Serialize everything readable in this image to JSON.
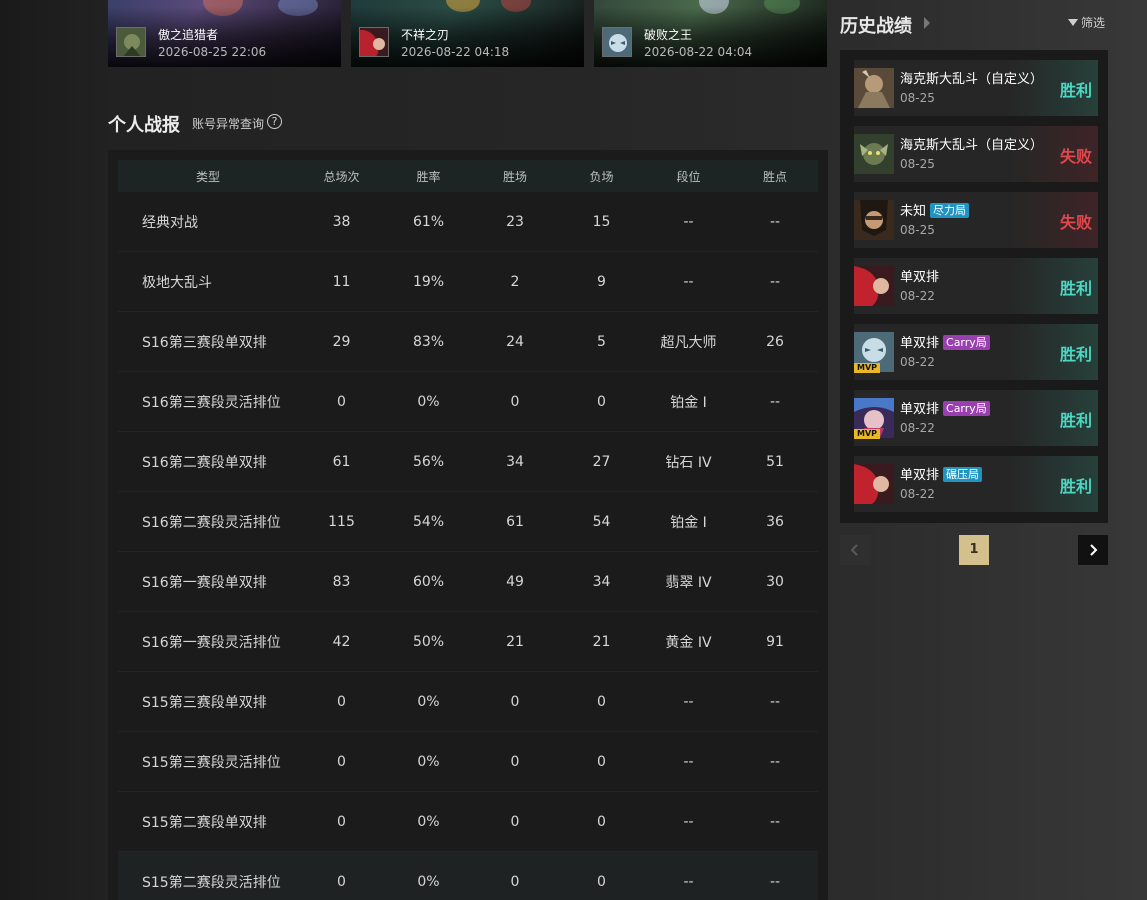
{
  "highlights": [
    {
      "name": "傲之追猎者",
      "time": "2026-08-25 22:06"
    },
    {
      "name": "不祥之刃",
      "time": "2026-08-22 04:18"
    },
    {
      "name": "破败之王",
      "time": "2026-08-22 04:04"
    }
  ],
  "personal": {
    "title": "个人战报",
    "abnormal_link": "账号异常查询",
    "help_icon": "?"
  },
  "stats": {
    "headers": [
      "类型",
      "总场次",
      "胜率",
      "胜场",
      "负场",
      "段位",
      "胜点"
    ],
    "rows": [
      [
        "经典对战",
        "38",
        "61%",
        "23",
        "15",
        "--",
        "--"
      ],
      [
        "极地大乱斗",
        "11",
        "19%",
        "2",
        "9",
        "--",
        "--"
      ],
      [
        "S16第三赛段单双排",
        "29",
        "83%",
        "24",
        "5",
        "超凡大师",
        "26"
      ],
      [
        "S16第三赛段灵活排位",
        "0",
        "0%",
        "0",
        "0",
        "铂金 Ⅰ",
        "--"
      ],
      [
        "S16第二赛段单双排",
        "61",
        "56%",
        "34",
        "27",
        "钻石 IV",
        "51"
      ],
      [
        "S16第二赛段灵活排位",
        "115",
        "54%",
        "61",
        "54",
        "铂金 Ⅰ",
        "36"
      ],
      [
        "S16第一赛段单双排",
        "83",
        "60%",
        "49",
        "34",
        "翡翠 IV",
        "30"
      ],
      [
        "S16第一赛段灵活排位",
        "42",
        "50%",
        "21",
        "21",
        "黄金 IV",
        "91"
      ],
      [
        "S15第三赛段单双排",
        "0",
        "0%",
        "0",
        "0",
        "--",
        "--"
      ],
      [
        "S15第三赛段灵活排位",
        "0",
        "0%",
        "0",
        "0",
        "--",
        "--"
      ],
      [
        "S15第二赛段单双排",
        "0",
        "0%",
        "0",
        "0",
        "--",
        "--"
      ],
      [
        "S15第二赛段灵活排位",
        "0",
        "0%",
        "0",
        "0",
        "--",
        "--"
      ]
    ]
  },
  "history": {
    "title": "历史战绩",
    "filter_label": "筛选",
    "matches": [
      {
        "mode": "海克斯大乱斗（自定义）",
        "tag": "",
        "date": "08-25",
        "result": "胜利",
        "outcome": "win",
        "mvp": ""
      },
      {
        "mode": "海克斯大乱斗（自定义）",
        "tag": "",
        "date": "08-25",
        "result": "失败",
        "outcome": "lose",
        "mvp": ""
      },
      {
        "mode": "未知",
        "tag": "尽力局",
        "date": "08-25",
        "result": "失败",
        "outcome": "lose",
        "mvp": ""
      },
      {
        "mode": "单双排",
        "tag": "",
        "date": "08-22",
        "result": "胜利",
        "outcome": "win",
        "mvp": ""
      },
      {
        "mode": "单双排",
        "tag": "Carry局",
        "date": "08-22",
        "result": "胜利",
        "outcome": "win",
        "mvp": "MVP"
      },
      {
        "mode": "单双排",
        "tag": "Carry局",
        "date": "08-22",
        "result": "胜利",
        "outcome": "win",
        "mvp": "MVP"
      },
      {
        "mode": "单双排",
        "tag": "碾压局",
        "date": "08-22",
        "result": "胜利",
        "outcome": "win",
        "mvp": ""
      }
    ]
  },
  "pagination": {
    "current_page": "1"
  },
  "colors": {
    "win": "#4dd6c2",
    "lose": "#e0484c",
    "page_active": "#d4c08c",
    "tag_carry": "#9a3fb0",
    "tag_effort": "#1f94c3",
    "mvp_badge": "#e8b826"
  }
}
